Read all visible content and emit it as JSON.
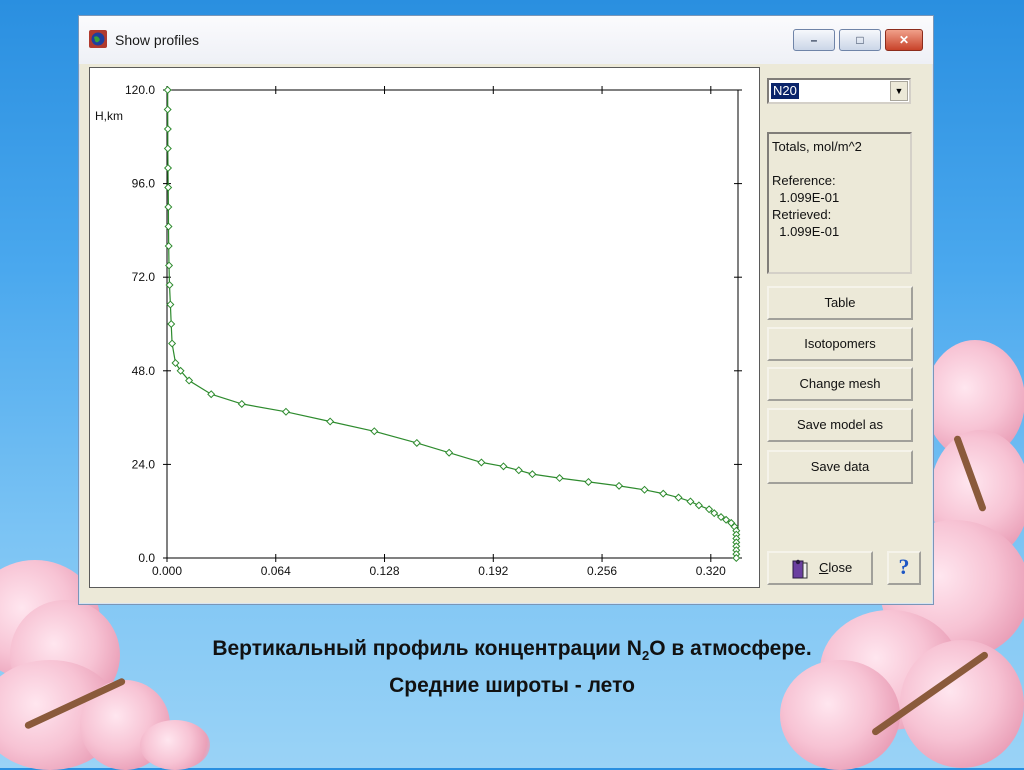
{
  "window": {
    "title": "Show profiles",
    "minimize_glyph": "–",
    "maximize_glyph": "□",
    "close_glyph": "✕"
  },
  "sidebar": {
    "gas_select": "N20",
    "totals": {
      "title": "Totals, mol/m^2",
      "reference_label": "Reference:",
      "reference_value": "  1.099E-01",
      "retrieved_label": "Retrieved:",
      "retrieved_value": "  1.099E-01"
    },
    "buttons": {
      "table": "Table",
      "isotopomers": "Isotopomers",
      "change_mesh": "Change mesh",
      "save_model": "Save model as",
      "save_data": "Save data"
    },
    "close_label_prefix": "C",
    "close_label_rest": "lose",
    "help_glyph": "?"
  },
  "caption": {
    "line1_a": "Вертикальный профиль концентрации N",
    "line1_sub": "2",
    "line1_b": "O в атмосфере.",
    "line2": "Средние широты - лето"
  },
  "chart_data": {
    "type": "line",
    "ylabel": "H,km",
    "xlim": [
      0.0,
      0.336
    ],
    "ylim": [
      0.0,
      120.0
    ],
    "x_ticks": [
      "0.000",
      "0.064",
      "0.128",
      "0.192",
      "0.256",
      "0.320"
    ],
    "y_ticks": [
      "0.0",
      "24.0",
      "48.0",
      "72.0",
      "96.0",
      "120.0"
    ],
    "line_color": "#2e8b2e",
    "marker": "diamond-open",
    "series": [
      {
        "points": [
          [
            0.0004,
            120
          ],
          [
            0.0004,
            115
          ],
          [
            0.0005,
            110
          ],
          [
            0.0005,
            105
          ],
          [
            0.0006,
            100
          ],
          [
            0.0007,
            95
          ],
          [
            0.0008,
            90
          ],
          [
            0.0009,
            85
          ],
          [
            0.001,
            80
          ],
          [
            0.0012,
            75
          ],
          [
            0.0015,
            70
          ],
          [
            0.002,
            65
          ],
          [
            0.0025,
            60
          ],
          [
            0.003,
            55
          ],
          [
            0.005,
            50
          ],
          [
            0.008,
            48
          ],
          [
            0.013,
            45.5
          ],
          [
            0.026,
            42
          ],
          [
            0.044,
            39.5
          ],
          [
            0.07,
            37.5
          ],
          [
            0.096,
            35
          ],
          [
            0.122,
            32.5
          ],
          [
            0.147,
            29.5
          ],
          [
            0.166,
            27
          ],
          [
            0.185,
            24.5
          ],
          [
            0.198,
            23.5
          ],
          [
            0.207,
            22.5
          ],
          [
            0.215,
            21.5
          ],
          [
            0.231,
            20.5
          ],
          [
            0.248,
            19.5
          ],
          [
            0.266,
            18.5
          ],
          [
            0.281,
            17.5
          ],
          [
            0.292,
            16.5
          ],
          [
            0.301,
            15.5
          ],
          [
            0.308,
            14.5
          ],
          [
            0.313,
            13.5
          ],
          [
            0.319,
            12.5
          ],
          [
            0.322,
            11.5
          ],
          [
            0.326,
            10.5
          ],
          [
            0.329,
            9.8
          ],
          [
            0.332,
            9.0
          ],
          [
            0.334,
            8.0
          ],
          [
            0.335,
            7.0
          ],
          [
            0.335,
            6.0
          ],
          [
            0.335,
            5.0
          ],
          [
            0.335,
            4.0
          ],
          [
            0.335,
            3.0
          ],
          [
            0.335,
            2.0
          ],
          [
            0.335,
            1.0
          ],
          [
            0.335,
            0.0
          ]
        ]
      }
    ]
  }
}
